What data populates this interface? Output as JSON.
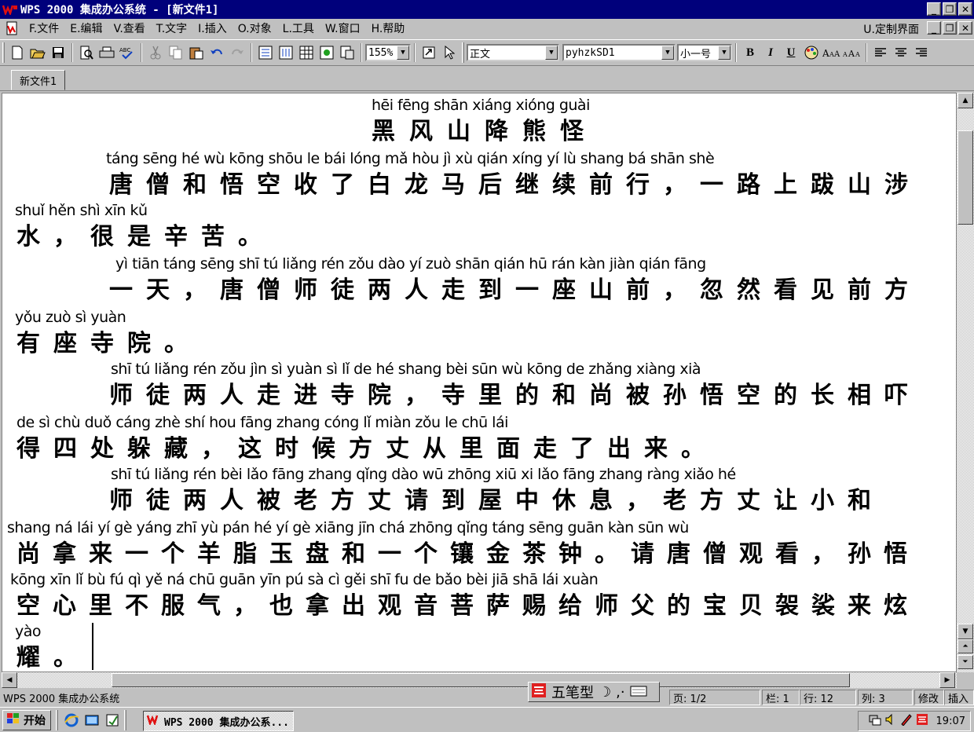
{
  "titlebar": {
    "title": "WPS 2000 集成办公系统 - [新文件1]",
    "min": "_",
    "max": "❐",
    "close": "✕"
  },
  "menubar": {
    "items": [
      "F.文件",
      "E.编辑",
      "V.查看",
      "T.文字",
      "I.插入",
      "O.对象",
      "L.工具",
      "W.窗口",
      "H.帮助"
    ],
    "right_item": "U.定制界面"
  },
  "toolbar": {
    "zoom": "155%",
    "style": "正文",
    "font": "pyhzkSD1",
    "size": "小一号",
    "bold": "B",
    "italic": "I",
    "underline": "U"
  },
  "tab": {
    "label": "新文件1"
  },
  "document": {
    "lines": [
      {
        "pinyin": "hēi  fēng  shān xiáng xióng  guài",
        "hanzi": "黑风山降熊怪"
      },
      {
        "pinyin": "táng sēng  hé   wù  kōng  shōu   le    bái  lóng  mǎ   hòu    jì    xù  qián  xíng          yí    lù  shang bá  shān  shè",
        "hanzi": "唐僧和悟空收了白龙马后继续前行，一路上跋山涉"
      },
      {
        "pinyin": "shuǐ        hěn  shì   xīn   kǔ",
        "hanzi": "水，很是辛苦。"
      },
      {
        "pinyin": "yì   tiān          táng sēng  shī    tú   liǎng  rén  zǒu  dào    yí   zuò  shān qián          hū    rán   kàn   jiàn  qián  fāng",
        "hanzi": "一天，唐僧师徒两人走到一座山前，忽然看见前方"
      },
      {
        "pinyin": "yǒu  zuò    sì   yuàn",
        "hanzi": "有座寺院。"
      },
      {
        "pinyin": "shī    tú   liǎng  rén  zǒu   jìn    sì   yuàn          sì    lǐ    de    hé   shang bèi   sūn   wù  kōng   de  zhǎng xiàng  xià",
        "hanzi": "师徒两人走进寺院，寺里的和尚被孙悟空的长相吓"
      },
      {
        "pinyin": "de     sì    chù  duǒ cáng          zhè   shí  hou  fāng  zhang cóng    lǐ    miàn zǒu    le    chū    lái",
        "hanzi": "得四处躲藏，这时候方丈从里面走了出来。"
      },
      {
        "pinyin": "shī    tú   liǎng  rén   bèi   lǎo  fāng  zhang  qǐng dào  wū zhōng xiū     xi            lǎo  fāng  zhang  ràng xiǎo   hé",
        "hanzi": "师徒两人被老方丈请到屋中休息，老方丈让小和"
      },
      {
        "pinyin": "shang ná    lái    yí    gè  yáng  zhī    yù   pán   hé    yí    gè   xiāng  jīn   chá zhōng          qǐng táng sēng guān  kàn           sūn   wù",
        "hanzi": "尚拿来一个羊脂玉盘和一个镶金茶钟。请唐僧观看，孙悟"
      },
      {
        "pinyin": "kōng  xīn     lǐ    bù    fú    qì           yě    ná   chū  guān  yīn   pú    sà    cì    gěi   shī    fu    de   bǎo   bèi    jiā   shā   lái  xuàn",
        "hanzi": "空心里不服气，也拿出观音菩萨赐给师父的宝贝袈裟来炫"
      },
      {
        "pinyin": "yào",
        "hanzi": "耀。"
      }
    ]
  },
  "ime": {
    "label": "五笔型"
  },
  "statusbar": {
    "app": "WPS 2000 集成办公系统",
    "page": "页: 1/2",
    "column": "栏: 1",
    "row": "行: 12",
    "col": "列: 3",
    "mode1": "修改",
    "mode2": "插入"
  },
  "taskbar": {
    "start": "开始",
    "task": "WPS 2000 集成办公系...",
    "clock": "19:07"
  }
}
